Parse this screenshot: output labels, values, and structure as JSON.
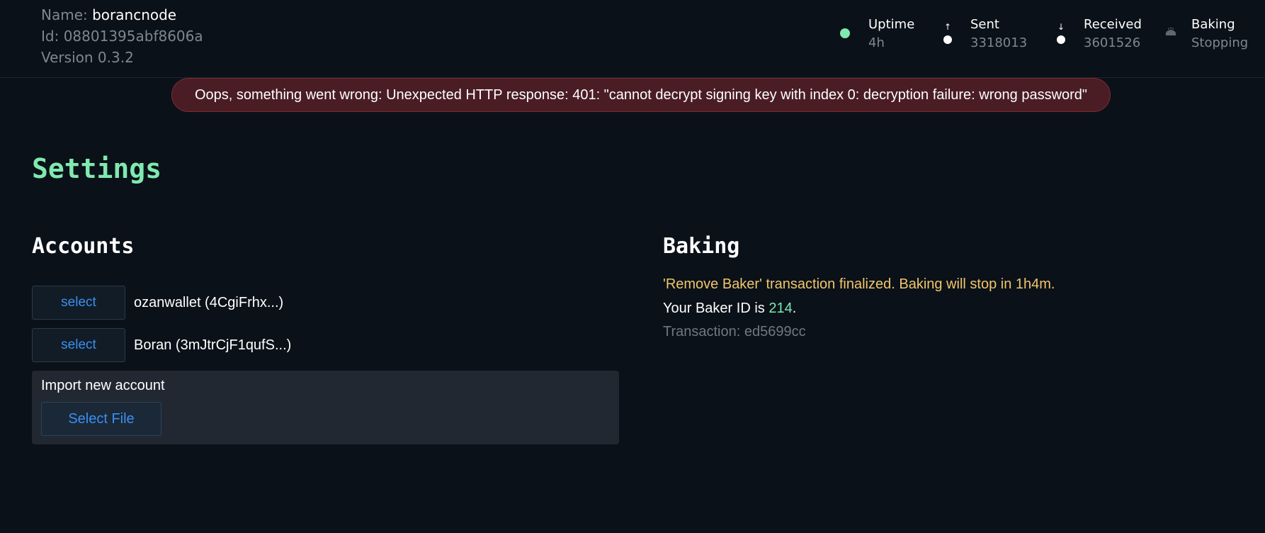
{
  "node": {
    "name_label": "Name:",
    "name": "borancnode",
    "id_text": "Id: 08801395abf8606a",
    "version_text": "Version 0.3.2"
  },
  "stats": {
    "uptime": {
      "label": "Uptime",
      "value": "4h"
    },
    "sent": {
      "label": "Sent",
      "value": "3318013"
    },
    "received": {
      "label": "Received",
      "value": "3601526"
    },
    "baking": {
      "label": "Baking",
      "value": "Stopping"
    }
  },
  "colors": {
    "accent_green": "#7fe9b0",
    "link_blue": "#3b8ff0",
    "warning_yellow": "#f0c66a",
    "error_bg": "#4a1d24"
  },
  "error": {
    "message": "Oops, something went wrong: Unexpected HTTP response: 401: \"cannot decrypt signing key with index 0: decryption failure: wrong password\""
  },
  "page": {
    "title": "Settings"
  },
  "accounts": {
    "title": "Accounts",
    "items": [
      {
        "button": "select",
        "label": "ozanwallet (4CgiFrhx...)"
      },
      {
        "button": "select",
        "label": "Boran (3mJtrCjF1qufS...)"
      }
    ],
    "import": {
      "title": "Import new account",
      "button": "Select File"
    }
  },
  "baking": {
    "title": "Baking",
    "status_message": "'Remove Baker' transaction finalized. Baking will stop in 1h4m.",
    "baker_id_prefix": "Your Baker ID is ",
    "baker_id": "214",
    "baker_id_suffix": ".",
    "transaction": "Transaction: ed5699cc"
  }
}
